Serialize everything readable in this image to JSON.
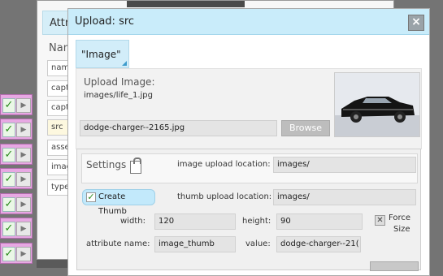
{
  "attributes_window": {
    "tab": "Attri",
    "name_header": "Nam",
    "fields": [
      "nam",
      "capti",
      "capti",
      "src",
      "asse",
      "imag",
      "type"
    ]
  },
  "dialog": {
    "title": "Upload: src",
    "close": "×",
    "tab": "\"Image\"",
    "upload_label": "Upload Image:",
    "current_path": "images/life_1.jpg",
    "file_value": "dodge-charger--2165.jpg",
    "browse": "Browse"
  },
  "settings": {
    "label": "Settings",
    "image_upload_location_label": "image upload location:",
    "image_upload_location": "images/",
    "create_thumb_label": "Create Thumb",
    "create_thumb_checked": true,
    "thumb_upload_location_label": "thumb upload location:",
    "thumb_upload_location": "images/",
    "width_label": "width:",
    "width": "120",
    "height_label": "height:",
    "height": "90",
    "force_size_label_1": "Force",
    "force_size_label_2": "Size",
    "attribute_name_label": "attribute name:",
    "attribute_name": "image_thumb",
    "value_label": "value:",
    "value": "dodge-charger--21("
  },
  "row_controls": {
    "check": "✓",
    "arrow": "▶"
  },
  "colors": {
    "title_bg": "#c9ecfa",
    "row_pink": "#e7a8e3"
  }
}
